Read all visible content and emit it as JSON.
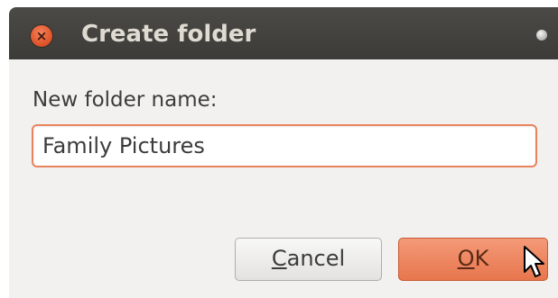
{
  "dialog": {
    "title": "Create folder",
    "close_icon": "close-icon",
    "menu_icon": "window-menu-icon",
    "prompt_label": "New folder name:",
    "folder_name_value": "Family Pictures",
    "cancel_button": {
      "mnemonic": "C",
      "rest": "ancel"
    },
    "ok_button": {
      "mnemonic": "O",
      "rest": "K"
    },
    "accent_color": "#e8845d",
    "titlebar_color": "#3c3b37"
  }
}
